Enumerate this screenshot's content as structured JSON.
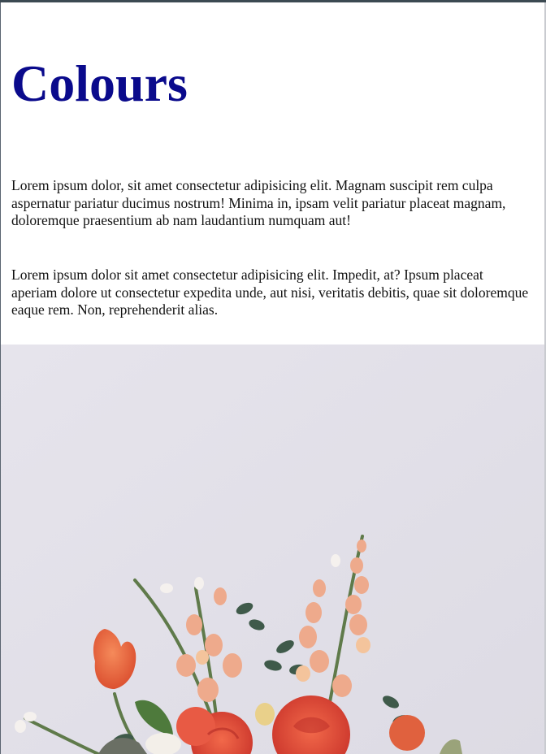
{
  "page": {
    "title": "Colours",
    "paragraphs": [
      "Lorem ipsum dolor, sit amet consectetur adipisicing elit. Magnam suscipit rem culpa aspernatur pariatur ducimus nostrum! Minima in, ipsam velit pariatur placeat magnam, doloremque praesentium ab nam laudantium numquam aut!",
      "Lorem ipsum dolor sit amet consectetur adipisicing elit. Impedit, at? Ipsum placeat aperiam dolore ut consectetur expedita unde, aut nisi, veritatis debitis, quae sit doloremque eaque rem. Non, reprehenderit alias."
    ]
  },
  "hero_image": {
    "subject": "flower-bouquet-photo"
  },
  "colors": {
    "title": "#0a0a8c",
    "text": "#111111",
    "image_background": "#e4e2ea"
  }
}
